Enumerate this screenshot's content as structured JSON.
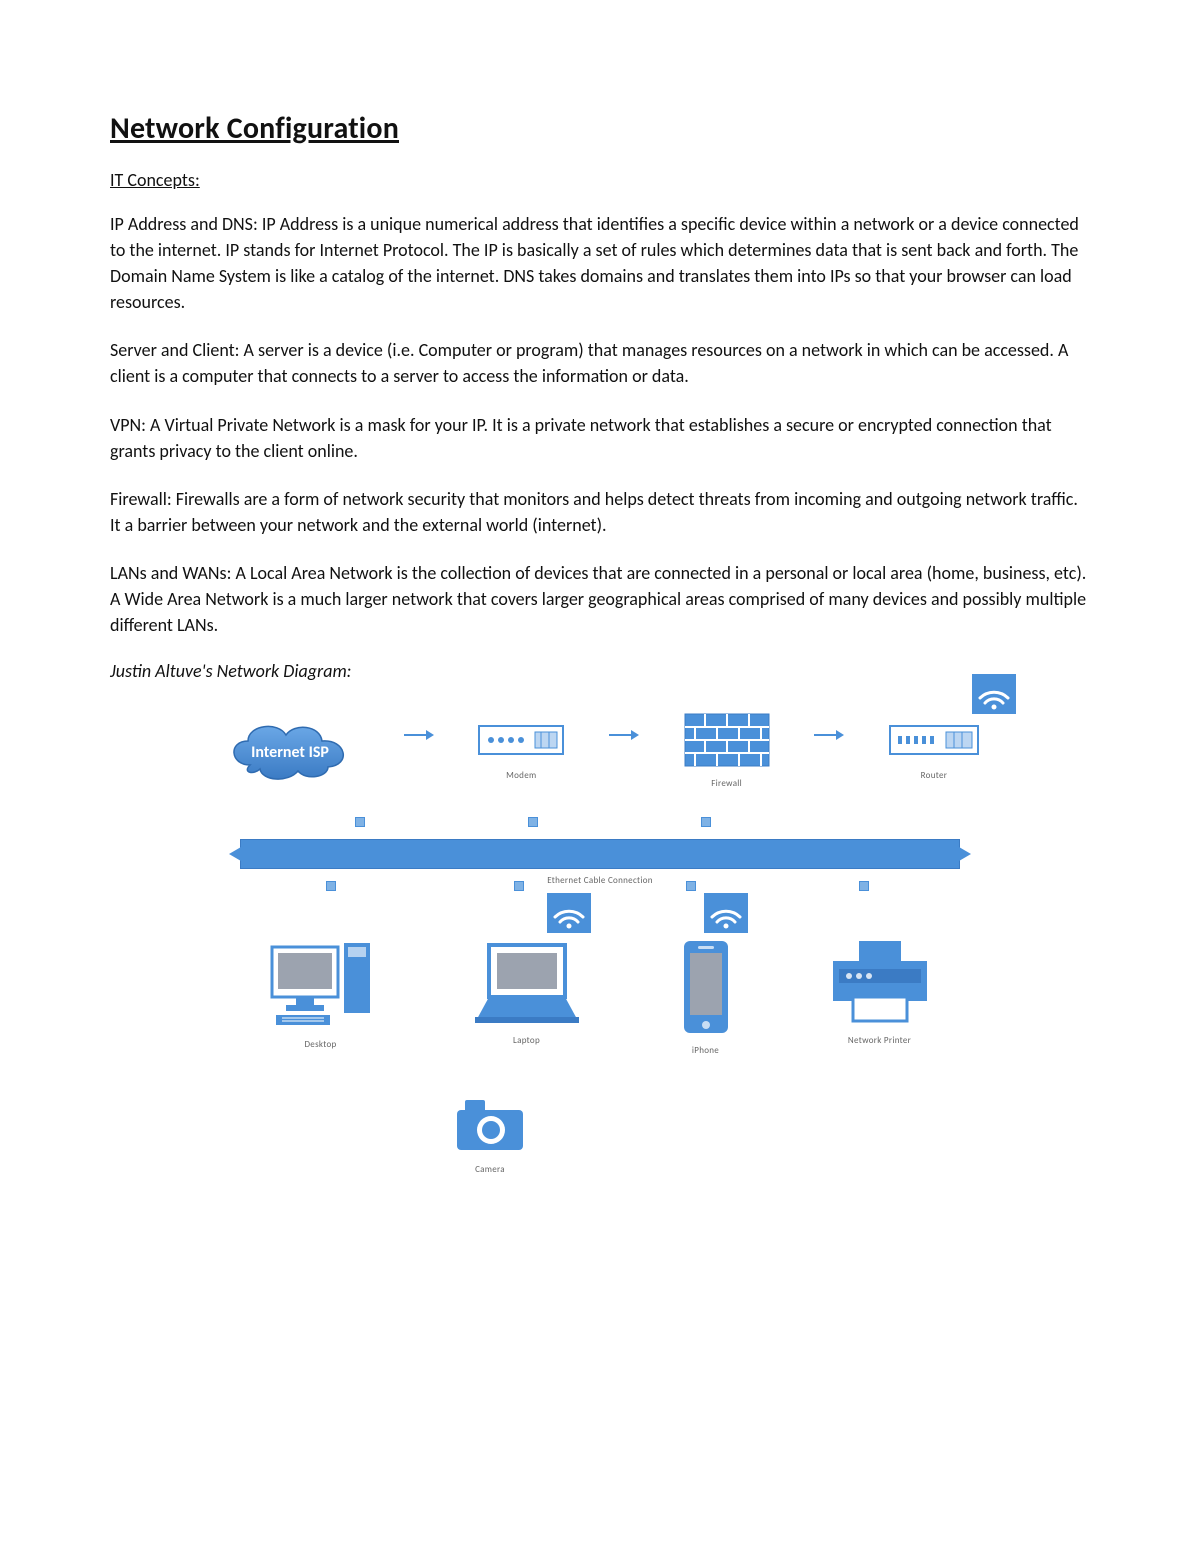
{
  "title": "Network Configuration",
  "subhead": "IT Concepts:",
  "paragraphs": {
    "ip_dns": "IP Address and DNS: IP Address is a unique numerical address that identifies a specific device within a network or a device connected to the internet. IP stands for Internet Protocol. The IP is basically a set of rules which determines data that is sent back and forth. The Domain Name System is like a catalog of the internet. DNS takes domains and translates them into IPs so that your browser can load resources.",
    "server_client": "Server and Client: A server is a device (i.e. Computer or program) that manages resources on a network in which can be accessed. A client is a computer that connects to a server to access the information or data.",
    "vpn": "VPN: A Virtual Private Network is a mask for your IP. It is a private network that establishes a secure or encrypted connection that grants privacy to the client online.",
    "firewall": "Firewall: Firewalls are a form of network security that monitors and helps detect threats from incoming and outgoing network traffic. It a barrier between your network and the external world (internet).",
    "lan_wan": "LANs and WANs: A Local Area Network is the collection of devices that are connected in a personal or local area (home, business, etc). A Wide Area Network is a much larger network that covers larger geographical areas comprised of many devices and possibly multiple different LANs."
  },
  "diagram_caption": "Justin Altuve's Network Diagram:",
  "diagram": {
    "cloud_label": "Internet ISP",
    "modem_label": "Modem",
    "firewall_label": "Firewall",
    "router_label": "Router",
    "ethernet_label": "Ethernet Cable Connection",
    "desktop_label": "Desktop",
    "laptop_label": "Laptop",
    "iphone_label": "iPhone",
    "printer_label": "Network Printer",
    "camera_label": "Camera"
  },
  "colors": {
    "blue": "#4a90d9",
    "blue_dark": "#3b7bc4",
    "blue_light": "#bcd6f2",
    "grey": "#9ca3af"
  }
}
